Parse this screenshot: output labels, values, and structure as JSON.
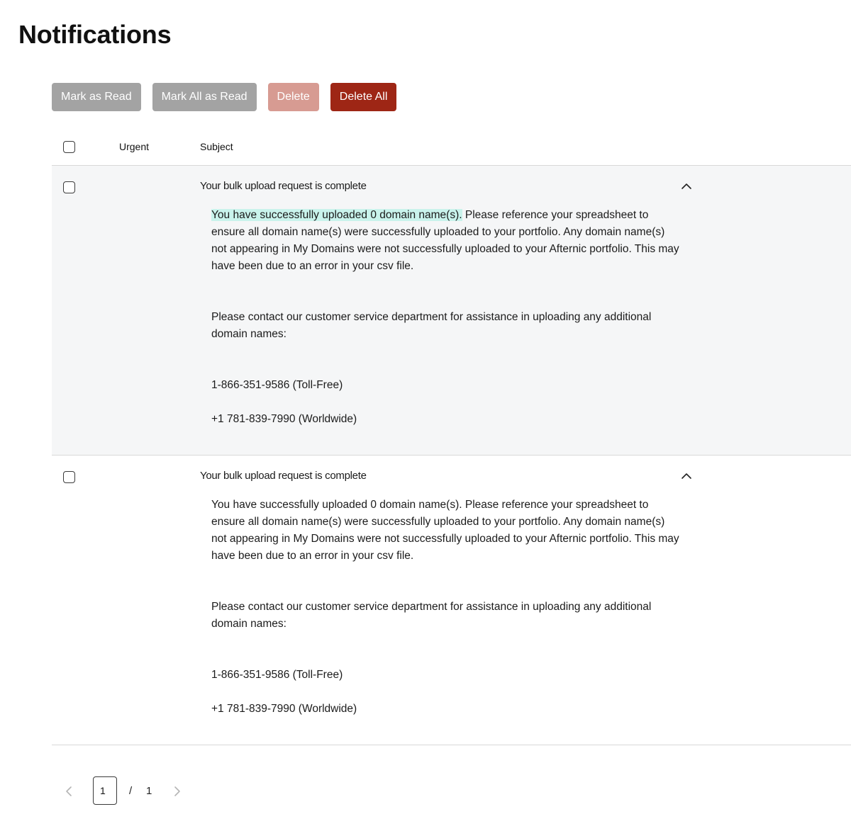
{
  "page": {
    "title": "Notifications"
  },
  "toolbar": {
    "mark_read_label": "Mark as Read",
    "mark_all_read_label": "Mark All as Read",
    "delete_label": "Delete",
    "delete_all_label": "Delete All"
  },
  "colors": {
    "disabled_gray": "#a3a3a3",
    "delete_disabled": "#d79b92",
    "delete_all": "#9e2615",
    "expanded_row_bg": "#f5f6f7",
    "highlight": "#c9f3ec"
  },
  "table": {
    "headers": {
      "urgent": "Urgent",
      "subject": "Subject"
    },
    "rows": [
      {
        "subject": "Your bulk upload request is complete",
        "expanded": true,
        "chevron_icon": "chevron-up-icon",
        "body": {
          "p1_highlight": "You have successfully uploaded 0 domain name(s).",
          "p1_rest": " Please reference your spreadsheet to ensure all domain name(s) were successfully uploaded to your portfolio. Any domain name(s) not appearing in My Domains were not successfully uploaded to your Afternic portfolio. This may have been due to an error in your csv file.",
          "p2": "Please contact our customer service department for assistance in uploading any additional domain names:",
          "phone_tollfree": "1-866-351-9586 (Toll-Free)",
          "phone_worldwide": "+1 781-839-7990 (Worldwide)"
        }
      },
      {
        "subject": "Your bulk upload request is complete",
        "expanded": true,
        "chevron_icon": "chevron-up-icon",
        "body": {
          "p1_highlight": "",
          "p1_rest": "You have successfully uploaded 0 domain name(s). Please reference your spreadsheet to ensure all domain name(s) were successfully uploaded to your portfolio. Any domain name(s) not appearing in My Domains were not successfully uploaded to your Afternic portfolio. This may have been due to an error in your csv file.",
          "p2": "Please contact our customer service department for assistance in uploading any additional domain names:",
          "phone_tollfree": "1-866-351-9586 (Toll-Free)",
          "phone_worldwide": "+1 781-839-7990 (Worldwide)"
        }
      }
    ]
  },
  "pagination": {
    "current_page": "1",
    "separator": "/",
    "total_pages": "1",
    "prev_icon": "chevron-left-icon",
    "next_icon": "chevron-right-icon"
  }
}
